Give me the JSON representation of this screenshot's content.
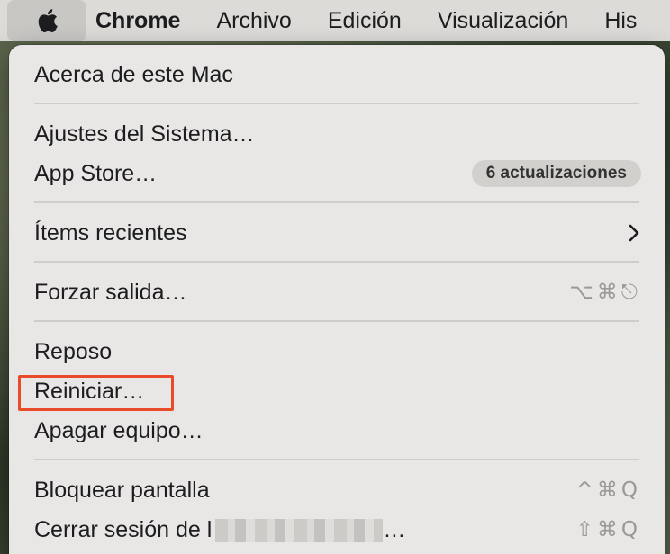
{
  "menubar": {
    "apple_icon": "apple-logo-icon",
    "items": [
      "Chrome",
      "Archivo",
      "Edición",
      "Visualización",
      "His"
    ]
  },
  "apple_menu": {
    "about": "Acerca de este Mac",
    "settings": "Ajustes del Sistema…",
    "app_store": "App Store…",
    "app_store_badge": "6 actualizaciones",
    "recent_items": "Ítems recientes",
    "force_quit": "Forzar salida…",
    "force_quit_shortcut": "⌥⌘⎋",
    "sleep": "Reposo",
    "restart": "Reiniciar…",
    "shutdown": "Apagar equipo…",
    "lock_screen": "Bloquear pantalla",
    "lock_screen_shortcut": "^⌘Q",
    "logout": "Cerrar sesión de l",
    "logout_suffix": "…",
    "logout_shortcut": "⇧⌘Q"
  },
  "colors": {
    "highlight_border": "#e84a2a"
  }
}
